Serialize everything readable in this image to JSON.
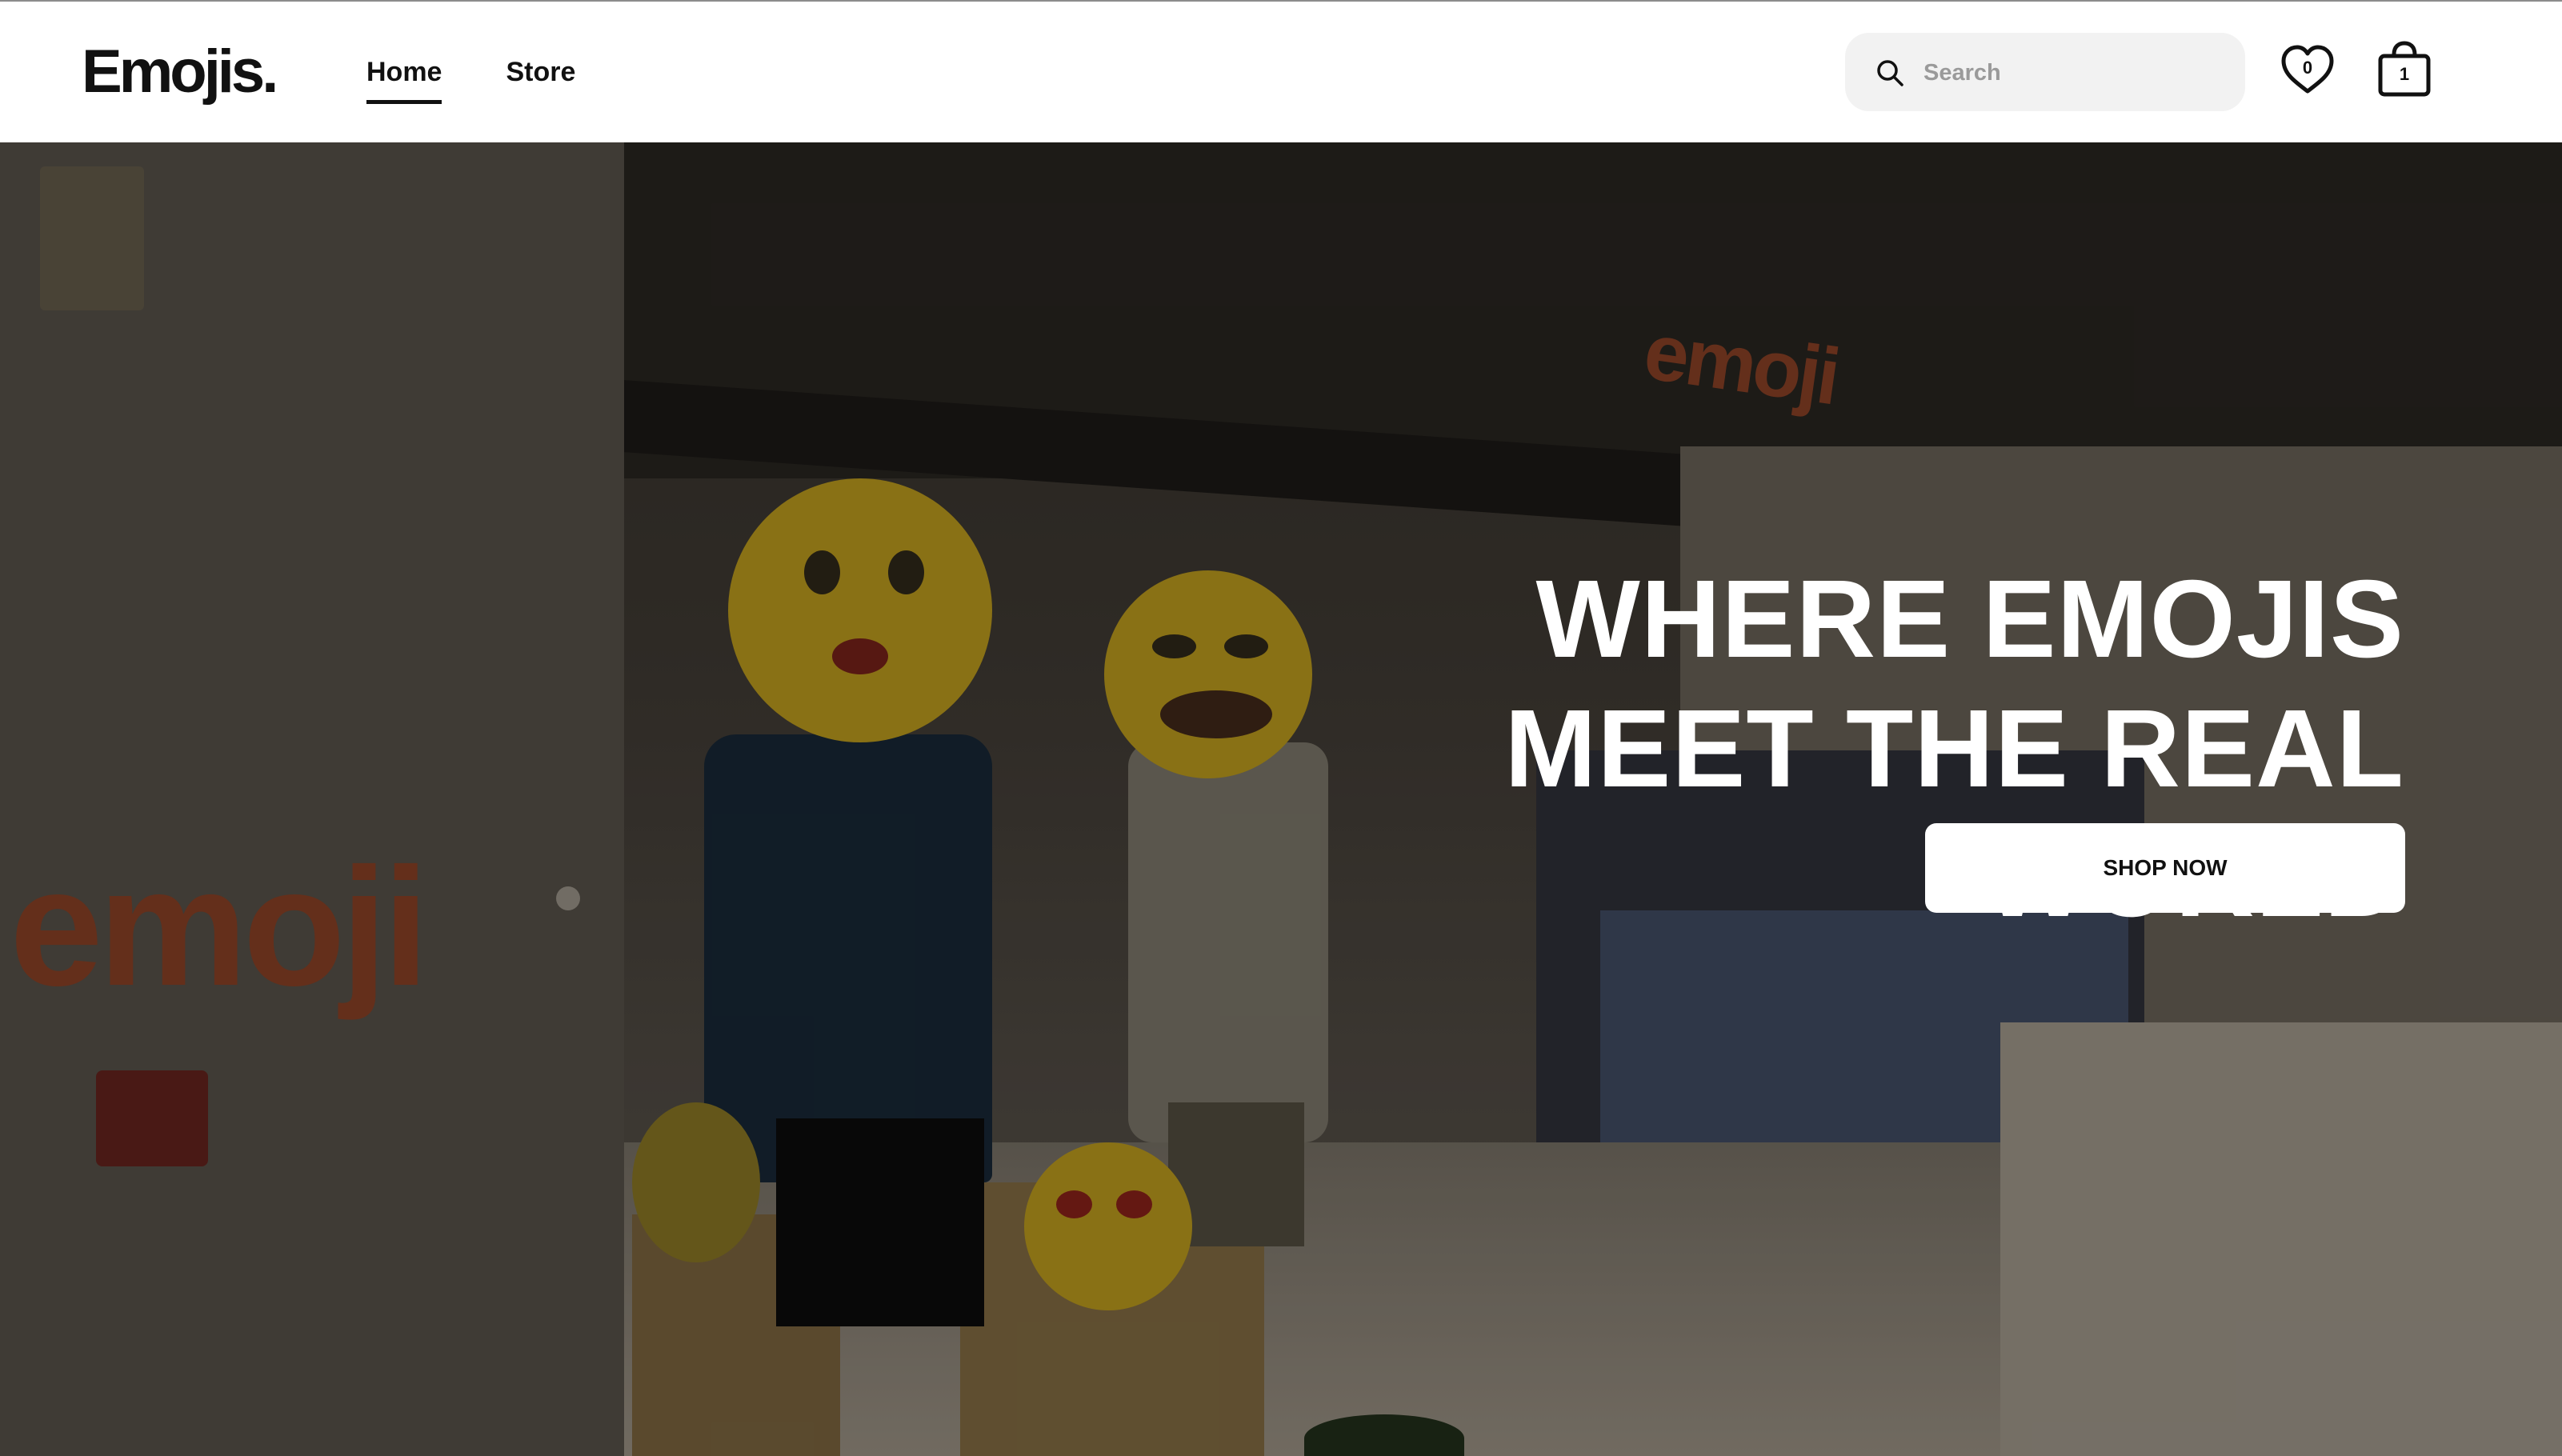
{
  "brand": {
    "logo": "Emojis."
  },
  "nav": {
    "items": [
      {
        "label": "Home",
        "active": true
      },
      {
        "label": "Store",
        "active": false
      }
    ]
  },
  "search": {
    "placeholder": "Search",
    "value": "",
    "icon": "search-icon"
  },
  "wishlist": {
    "icon": "heart-icon",
    "count": "0"
  },
  "cart": {
    "icon": "shopping-bag-icon",
    "count": "1"
  },
  "hero": {
    "headline": "WHERE EMOJIS MEET THE REAL WORLD",
    "cta_label": "SHOP NOW",
    "photo_signage": "emoji"
  },
  "colors": {
    "header_bg": "#ffffff",
    "text": "#111111",
    "search_bg": "#f2f2f2",
    "hero_text": "#ffffff",
    "cta_bg": "#ffffff"
  }
}
